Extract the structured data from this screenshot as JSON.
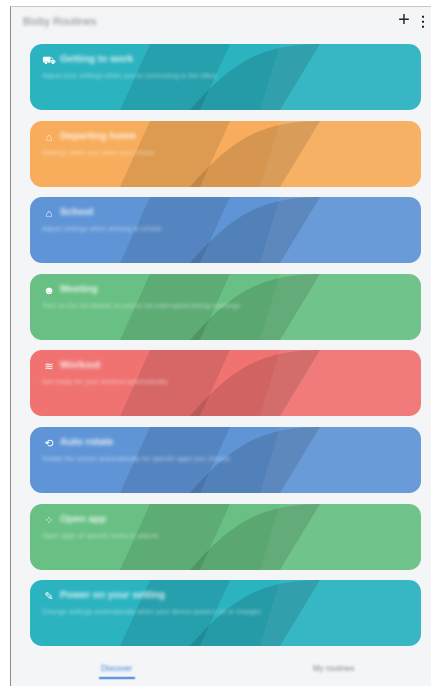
{
  "header": {
    "app_title": "Bixby Routines",
    "add_icon": "+",
    "more_icon": "⋮"
  },
  "cards": [
    {
      "title": "Getting to work",
      "description": "Adjust your settings when you're commuting to the office",
      "color": "#2bb3c0",
      "icon": "commute-icon",
      "glyph": "⛟"
    },
    {
      "title": "Departing home",
      "description": "Settings when you leave your house",
      "color": "#f7ad5b",
      "icon": "home-icon",
      "glyph": "⌂"
    },
    {
      "title": "School",
      "description": "Adjust settings when arriving at school",
      "color": "#5f95d6",
      "icon": "school-icon",
      "glyph": "⌂"
    },
    {
      "title": "Meeting",
      "description": "Turn on Do not disturb so you're not interrupted during meetings",
      "color": "#68c084",
      "icon": "people-icon",
      "glyph": "☻"
    },
    {
      "title": "Workout",
      "description": "Get ready for your workout automatically",
      "color": "#f07372",
      "icon": "workout-icon",
      "glyph": "≋"
    },
    {
      "title": "Auto rotate",
      "description": "Rotate the screen automatically for specific apps you choose",
      "color": "#5f95d6",
      "icon": "rotate-icon",
      "glyph": "⟲"
    },
    {
      "title": "Open app",
      "description": "Open apps at specific times or places",
      "color": "#68c084",
      "icon": "apps-icon",
      "glyph": "⁘"
    },
    {
      "title": "Power on your setting",
      "description": "Change settings automatically when your device powers on or charges",
      "color": "#2bb3c0",
      "icon": "magic-icon",
      "glyph": "✎"
    }
  ],
  "tabs": {
    "discover": "Discover",
    "my_routines": "My routines"
  }
}
